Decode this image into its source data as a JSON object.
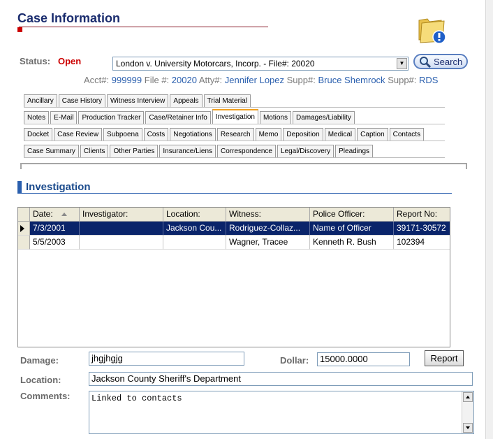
{
  "header": {
    "title": "Case Information"
  },
  "status": {
    "label": "Status:",
    "value": "Open"
  },
  "case_select": {
    "value": "London v. University Motorcars, Incorp. - File#: 20020"
  },
  "search": {
    "label": "Search"
  },
  "acct_line": {
    "acct_label": "Acct#:",
    "acct_value": "999999",
    "file_label": "File #:",
    "file_value": "20020",
    "atty_label": "Atty#:",
    "atty_value": "Jennifer Lopez",
    "supp1_label": "Supp#:",
    "supp1_value": "Bruce Shemrock",
    "supp2_label": "Supp#:",
    "supp2_value": "RDS"
  },
  "tabs": {
    "row1": [
      "Ancillary",
      "Case History",
      "Witness Interview",
      "Appeals",
      "Trial Material"
    ],
    "row2": [
      "Notes",
      "E-Mail",
      "Production Tracker",
      "Case/Retainer Info",
      "Investigation",
      "Motions",
      "Damages/Liability"
    ],
    "row3": [
      "Docket",
      "Case Review",
      "Subpoena",
      "Costs",
      "Negotiations",
      "Research",
      "Memo",
      "Deposition",
      "Medical",
      "Caption",
      "Contacts"
    ],
    "row4": [
      "Case Summary",
      "Clients",
      "Other Parties",
      "Insurance/Liens",
      "Correspondence",
      "Legal/Discovery",
      "Pleadings"
    ],
    "active": "Investigation"
  },
  "section": {
    "title": "Investigation"
  },
  "grid": {
    "columns": [
      "Date:",
      "Investigator:",
      "Location:",
      "Witness:",
      "Police Officer:",
      "Report No:"
    ],
    "rows": [
      [
        "7/3/2001",
        "",
        "Jackson Cou...",
        "Rodriguez-Collaz...",
        "Name of Officer",
        "39171-30572"
      ],
      [
        "5/5/2003",
        "",
        "",
        "Wagner, Tracee",
        "Kenneth R. Bush",
        "102394"
      ]
    ],
    "selected_row": 0
  },
  "form": {
    "damage_label": "Damage:",
    "damage_value": "jhgjhgjg",
    "dollar_label": "Dollar:",
    "dollar_value": "15000.0000",
    "report_label": "Report",
    "location_label": "Location:",
    "location_value": "Jackson County Sheriff's Department",
    "comments_label": "Comments:",
    "comments_value": "Linked to contacts"
  },
  "colors": {
    "title": "#1a2c6e",
    "status": "#cc0000",
    "link": "#2a5fae",
    "selection": "#0a246a",
    "active_tab_accent": "#f0a020"
  }
}
